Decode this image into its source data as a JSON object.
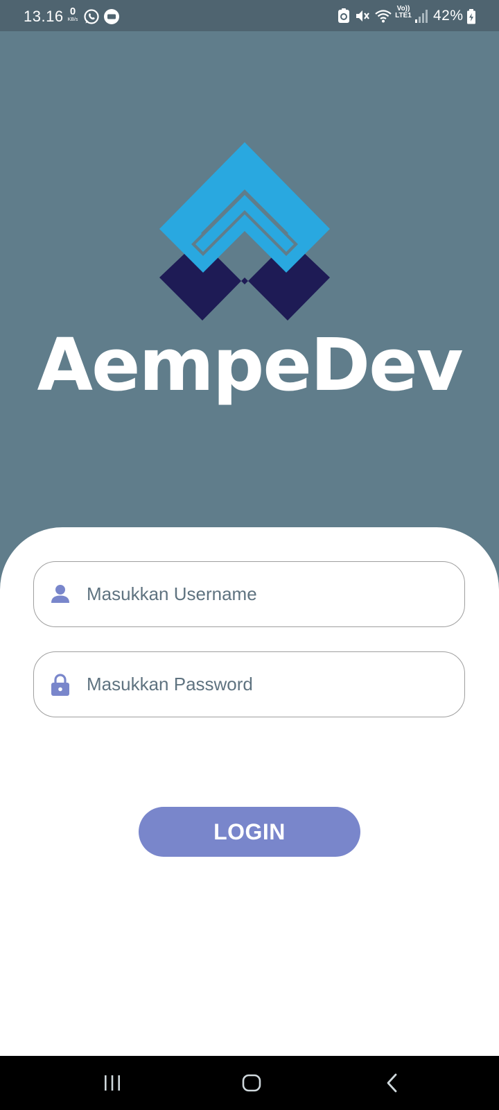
{
  "status_bar": {
    "time": "13.16",
    "net_speed_value": "0",
    "net_speed_unit": "KB/s",
    "network_label_top": "Vo))",
    "network_label_bottom": "LTE1",
    "battery_percent": "42%",
    "icons": [
      "whatsapp-icon",
      "screen-recorder-icon",
      "nfc-icon",
      "mute-icon",
      "wifi-icon",
      "signal-icon",
      "battery-charging-icon"
    ]
  },
  "brand": {
    "name": "AempeDev",
    "colors": {
      "primary": "#29a8e0",
      "secondary": "#1e1b55",
      "wordmark": "#ffffff"
    }
  },
  "form": {
    "username": {
      "value": "",
      "placeholder": "Masukkan Username",
      "icon": "person-icon"
    },
    "password": {
      "value": "",
      "placeholder": "Masukkan Password",
      "icon": "lock-icon"
    },
    "login_label": "LOGIN"
  },
  "nav_bar": {
    "buttons": [
      "recent-apps-icon",
      "home-icon",
      "back-icon"
    ]
  },
  "theme": {
    "background": "#607d8b",
    "status_bar": "#4f6470",
    "accent": "#7986cb",
    "card": "#ffffff"
  }
}
